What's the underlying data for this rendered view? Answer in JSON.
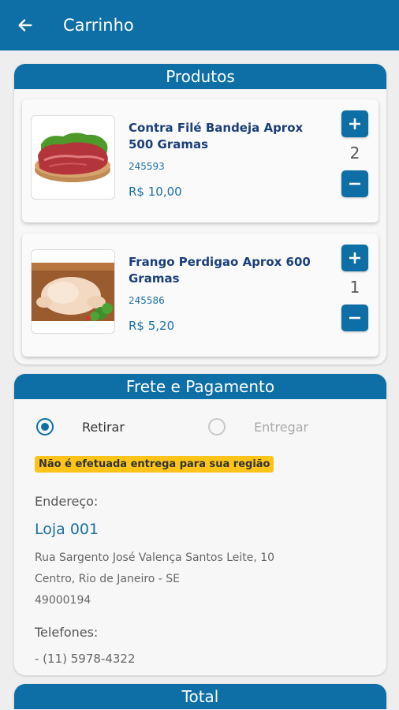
{
  "app_bar": {
    "title": "Carrinho",
    "back_icon": "arrow-left-icon"
  },
  "colors": {
    "primary": "#0d6fa6",
    "warning": "#fcc419",
    "product_name": "#1b3f7a"
  },
  "products_section": {
    "title": "Produtos",
    "items": [
      {
        "name": "Contra Filé Bandeja Aprox 500 Gramas",
        "code": "245593",
        "price": "R$ 10,00",
        "quantity": "2",
        "image": "beef-steak-image"
      },
      {
        "name": "Frango Perdigao Aprox 600 Gramas",
        "code": "245586",
        "price": "R$ 5,20",
        "quantity": "1",
        "image": "raw-chicken-image"
      }
    ]
  },
  "payment_section": {
    "title": "Frete e Pagamento",
    "options": [
      {
        "label": "Retirar",
        "selected": true
      },
      {
        "label": "Entregar",
        "selected": false
      }
    ],
    "warning": "Não é efetuada entrega para sua região",
    "address_label": "Endereço:",
    "store_name": "Loja 001",
    "address_lines": [
      "Rua Sargento José Valença Santos Leite, 10",
      "Centro, Rio de Janeiro - SE",
      "49000194"
    ],
    "phones_label": "Telefones:",
    "phone": "- (11) 5978-4322"
  },
  "total_section": {
    "title": "Total"
  }
}
